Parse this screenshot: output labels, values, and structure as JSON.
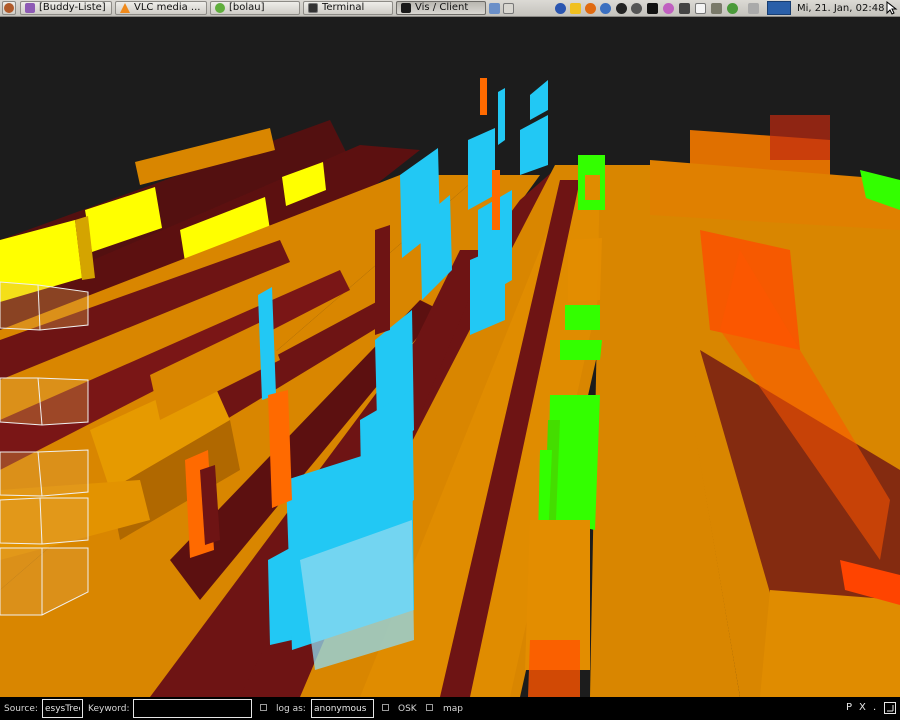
{
  "taskbar": {
    "tasks": [
      {
        "label": "[Buddy-Liste]",
        "color": "#8e5bb5"
      },
      {
        "label": "VLC media ...",
        "color": "#f08a1c"
      },
      {
        "label": "[bolau]",
        "color": "#5fae3c"
      },
      {
        "label": "Terminal",
        "color": "#333333"
      },
      {
        "label": "Vis / Client",
        "color": "#1a1a1a"
      }
    ],
    "clock": "Mi, 21. Jan, 02:48"
  },
  "bottom_bar": {
    "source_label": "Source:",
    "source_value": "esysTree",
    "keyword_label": "Keyword:",
    "keyword_value": "",
    "log_as_label": "log as:",
    "log_as_value": "anonymous",
    "osk_label": "OSK",
    "map_label": "map",
    "controls": [
      "P",
      "X",
      "."
    ]
  },
  "colors": {
    "background": "#1c1c1c",
    "orange": "#e08c00",
    "dark_red": "#6e1414",
    "cyan": "#22c8f4",
    "green": "#33ff00",
    "yellow": "#ffff00",
    "red_orange": "#ff4400"
  }
}
